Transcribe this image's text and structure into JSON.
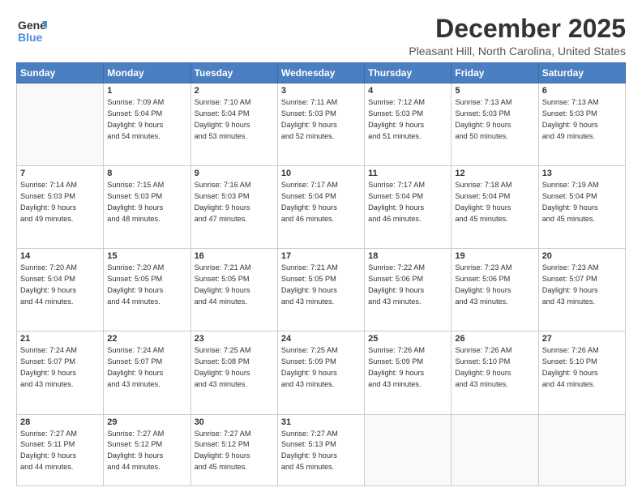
{
  "logo": {
    "line1": "General",
    "line2": "Blue"
  },
  "title": "December 2025",
  "subtitle": "Pleasant Hill, North Carolina, United States",
  "days_header": [
    "Sunday",
    "Monday",
    "Tuesday",
    "Wednesday",
    "Thursday",
    "Friday",
    "Saturday"
  ],
  "weeks": [
    [
      {
        "day": "",
        "info": ""
      },
      {
        "day": "1",
        "info": "Sunrise: 7:09 AM\nSunset: 5:04 PM\nDaylight: 9 hours\nand 54 minutes."
      },
      {
        "day": "2",
        "info": "Sunrise: 7:10 AM\nSunset: 5:04 PM\nDaylight: 9 hours\nand 53 minutes."
      },
      {
        "day": "3",
        "info": "Sunrise: 7:11 AM\nSunset: 5:03 PM\nDaylight: 9 hours\nand 52 minutes."
      },
      {
        "day": "4",
        "info": "Sunrise: 7:12 AM\nSunset: 5:03 PM\nDaylight: 9 hours\nand 51 minutes."
      },
      {
        "day": "5",
        "info": "Sunrise: 7:13 AM\nSunset: 5:03 PM\nDaylight: 9 hours\nand 50 minutes."
      },
      {
        "day": "6",
        "info": "Sunrise: 7:13 AM\nSunset: 5:03 PM\nDaylight: 9 hours\nand 49 minutes."
      }
    ],
    [
      {
        "day": "7",
        "info": "Sunrise: 7:14 AM\nSunset: 5:03 PM\nDaylight: 9 hours\nand 49 minutes."
      },
      {
        "day": "8",
        "info": "Sunrise: 7:15 AM\nSunset: 5:03 PM\nDaylight: 9 hours\nand 48 minutes."
      },
      {
        "day": "9",
        "info": "Sunrise: 7:16 AM\nSunset: 5:03 PM\nDaylight: 9 hours\nand 47 minutes."
      },
      {
        "day": "10",
        "info": "Sunrise: 7:17 AM\nSunset: 5:04 PM\nDaylight: 9 hours\nand 46 minutes."
      },
      {
        "day": "11",
        "info": "Sunrise: 7:17 AM\nSunset: 5:04 PM\nDaylight: 9 hours\nand 46 minutes."
      },
      {
        "day": "12",
        "info": "Sunrise: 7:18 AM\nSunset: 5:04 PM\nDaylight: 9 hours\nand 45 minutes."
      },
      {
        "day": "13",
        "info": "Sunrise: 7:19 AM\nSunset: 5:04 PM\nDaylight: 9 hours\nand 45 minutes."
      }
    ],
    [
      {
        "day": "14",
        "info": "Sunrise: 7:20 AM\nSunset: 5:04 PM\nDaylight: 9 hours\nand 44 minutes."
      },
      {
        "day": "15",
        "info": "Sunrise: 7:20 AM\nSunset: 5:05 PM\nDaylight: 9 hours\nand 44 minutes."
      },
      {
        "day": "16",
        "info": "Sunrise: 7:21 AM\nSunset: 5:05 PM\nDaylight: 9 hours\nand 44 minutes."
      },
      {
        "day": "17",
        "info": "Sunrise: 7:21 AM\nSunset: 5:05 PM\nDaylight: 9 hours\nand 43 minutes."
      },
      {
        "day": "18",
        "info": "Sunrise: 7:22 AM\nSunset: 5:06 PM\nDaylight: 9 hours\nand 43 minutes."
      },
      {
        "day": "19",
        "info": "Sunrise: 7:23 AM\nSunset: 5:06 PM\nDaylight: 9 hours\nand 43 minutes."
      },
      {
        "day": "20",
        "info": "Sunrise: 7:23 AM\nSunset: 5:07 PM\nDaylight: 9 hours\nand 43 minutes."
      }
    ],
    [
      {
        "day": "21",
        "info": "Sunrise: 7:24 AM\nSunset: 5:07 PM\nDaylight: 9 hours\nand 43 minutes."
      },
      {
        "day": "22",
        "info": "Sunrise: 7:24 AM\nSunset: 5:07 PM\nDaylight: 9 hours\nand 43 minutes."
      },
      {
        "day": "23",
        "info": "Sunrise: 7:25 AM\nSunset: 5:08 PM\nDaylight: 9 hours\nand 43 minutes."
      },
      {
        "day": "24",
        "info": "Sunrise: 7:25 AM\nSunset: 5:09 PM\nDaylight: 9 hours\nand 43 minutes."
      },
      {
        "day": "25",
        "info": "Sunrise: 7:26 AM\nSunset: 5:09 PM\nDaylight: 9 hours\nand 43 minutes."
      },
      {
        "day": "26",
        "info": "Sunrise: 7:26 AM\nSunset: 5:10 PM\nDaylight: 9 hours\nand 43 minutes."
      },
      {
        "day": "27",
        "info": "Sunrise: 7:26 AM\nSunset: 5:10 PM\nDaylight: 9 hours\nand 44 minutes."
      }
    ],
    [
      {
        "day": "28",
        "info": "Sunrise: 7:27 AM\nSunset: 5:11 PM\nDaylight: 9 hours\nand 44 minutes."
      },
      {
        "day": "29",
        "info": "Sunrise: 7:27 AM\nSunset: 5:12 PM\nDaylight: 9 hours\nand 44 minutes."
      },
      {
        "day": "30",
        "info": "Sunrise: 7:27 AM\nSunset: 5:12 PM\nDaylight: 9 hours\nand 45 minutes."
      },
      {
        "day": "31",
        "info": "Sunrise: 7:27 AM\nSunset: 5:13 PM\nDaylight: 9 hours\nand 45 minutes."
      },
      {
        "day": "",
        "info": ""
      },
      {
        "day": "",
        "info": ""
      },
      {
        "day": "",
        "info": ""
      }
    ]
  ]
}
